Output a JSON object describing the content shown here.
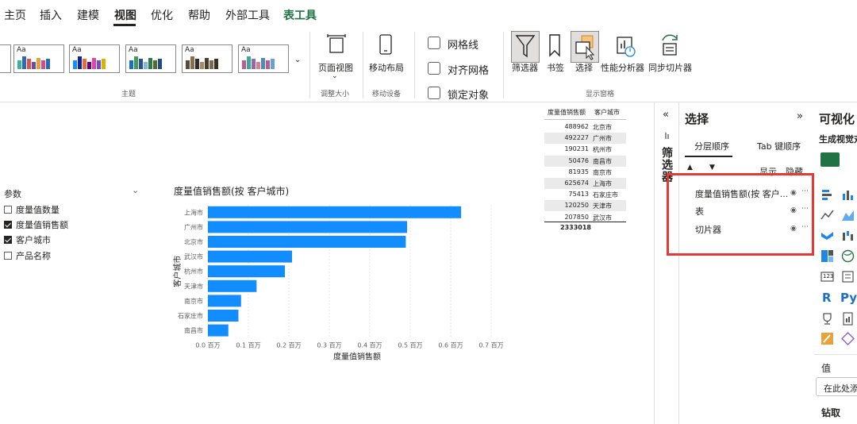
{
  "menu": {
    "items": [
      "主页",
      "插入",
      "建模",
      "视图",
      "优化",
      "帮助",
      "外部工具",
      "表工具"
    ],
    "active": "视图",
    "context": "表工具"
  },
  "ribbon": {
    "theme_label": "主题",
    "theme_aa": "Aa",
    "page_view": {
      "label": "页面视图",
      "group": "调整大小"
    },
    "mobile": {
      "label": "移动布局",
      "group": "移动设备"
    },
    "checks": [
      "网格线",
      "对齐网格",
      "锁定对象"
    ],
    "panes": [
      "筛选器",
      "书签",
      "选择",
      "性能分析器",
      "同步切片器"
    ],
    "panes_group": "显示窗格"
  },
  "fields": {
    "header": "参数",
    "items": [
      {
        "label": "度量值数量",
        "checked": false
      },
      {
        "label": "度量值销售额",
        "checked": true
      },
      {
        "label": "客户城市",
        "checked": true
      },
      {
        "label": "产品名称",
        "checked": false
      }
    ]
  },
  "chart_data": {
    "type": "bar",
    "orientation": "horizontal",
    "title": "度量值销售额(按 客户城市)",
    "xlabel": "度量值销售额",
    "ylabel": "客户城市",
    "categories": [
      "上海市",
      "广州市",
      "北京市",
      "武汉市",
      "杭州市",
      "天津市",
      "南京市",
      "石家庄市",
      "南昌市"
    ],
    "values": [
      625674,
      492227,
      488962,
      207850,
      190231,
      120250,
      81935,
      75413,
      50476
    ],
    "xlim": [
      0,
      700000
    ],
    "xticks": [
      "0.0 百万",
      "0.1 百万",
      "0.2 百万",
      "0.3 百万",
      "0.4 百万",
      "0.5 百万",
      "0.6 百万",
      "0.7 百万"
    ],
    "grid": true,
    "color": "#118DFF"
  },
  "table": {
    "headers": [
      "度量值销售额",
      "客户城市"
    ],
    "rows": [
      {
        "value": "488962",
        "city": "北京市"
      },
      {
        "value": "492227",
        "city": "广州市"
      },
      {
        "value": "190231",
        "city": "杭州市"
      },
      {
        "value": "50476",
        "city": "南昌市"
      },
      {
        "value": "81935",
        "city": "南京市"
      },
      {
        "value": "625674",
        "city": "上海市"
      },
      {
        "value": "75413",
        "city": "石家庄市"
      },
      {
        "value": "120250",
        "city": "天津市"
      },
      {
        "value": "207850",
        "city": "武汉市"
      }
    ],
    "total": "2333018"
  },
  "filter_strip": {
    "label": "筛选器"
  },
  "selection_pane": {
    "title": "选择",
    "tabs": [
      "分层顺序",
      "Tab 键顺序"
    ],
    "show": "显示",
    "hide": "隐藏",
    "layers": [
      "度量值销售额(按 客户...",
      "表",
      "切片器"
    ],
    "highlight_color": "#E53935"
  },
  "viz_pane": {
    "title": "可视化",
    "subtitle": "生成视觉对",
    "values_label": "值",
    "values_placeholder": "在此处添",
    "drill": "钻取",
    "r_label": "R",
    "py_label": "Py",
    "num_label": "123"
  }
}
